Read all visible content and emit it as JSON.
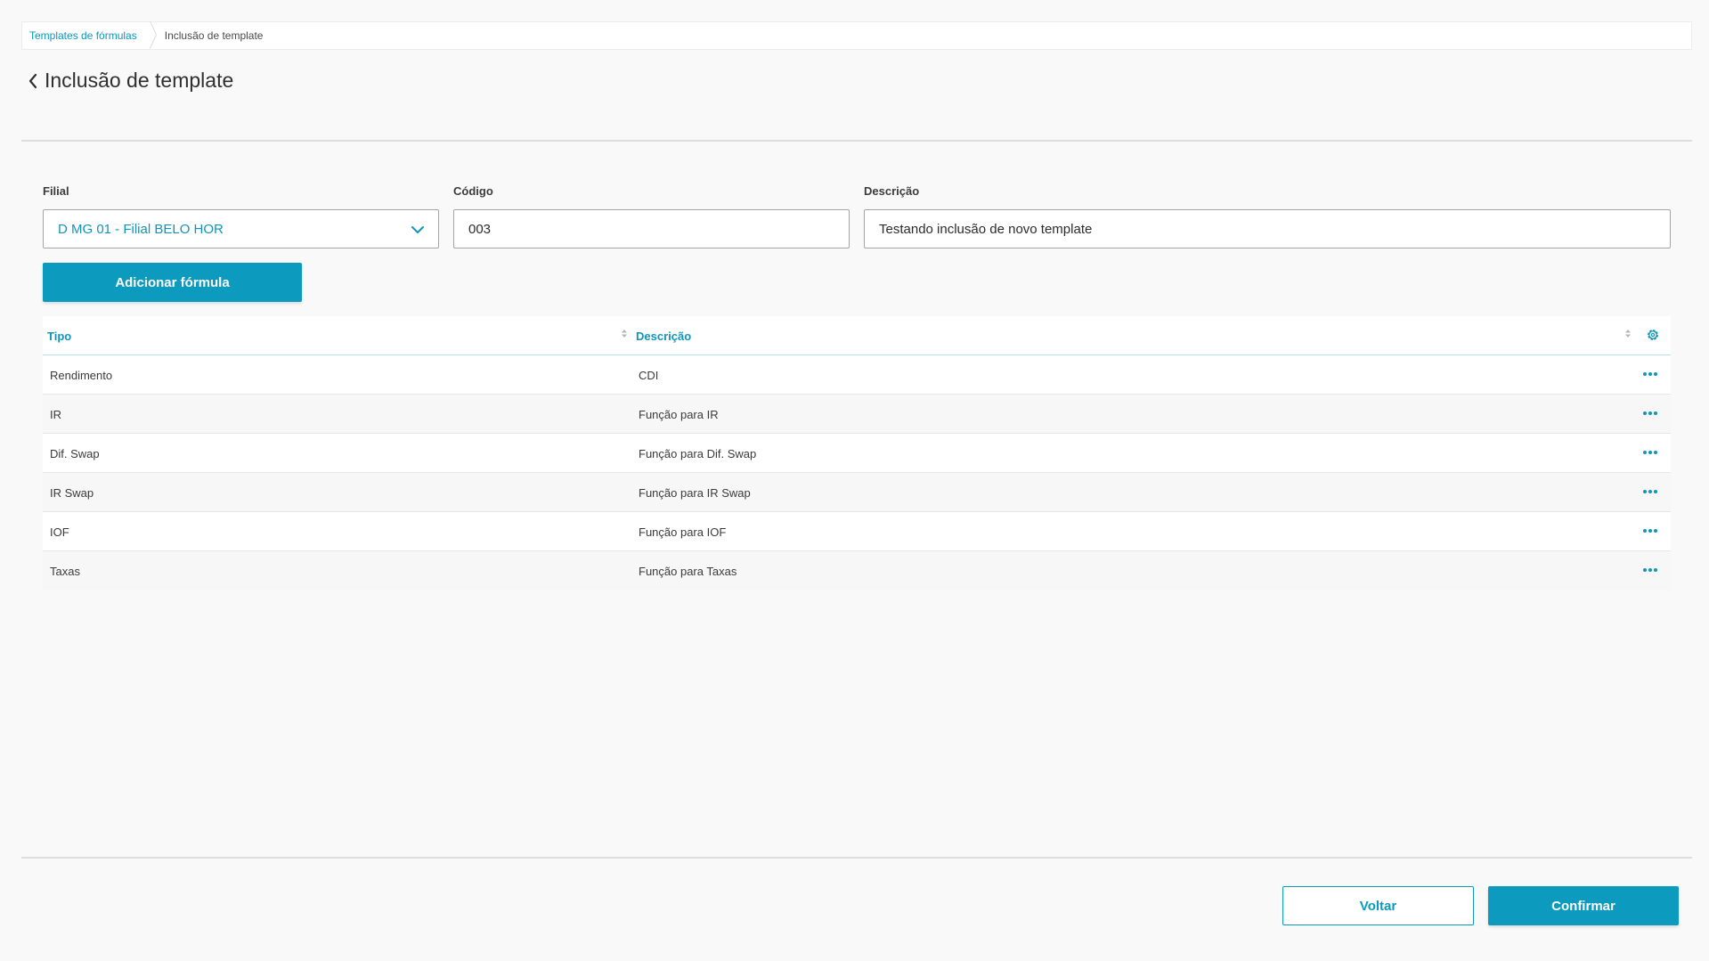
{
  "breadcrumb": {
    "items": [
      {
        "label": "Templates de fórmulas"
      },
      {
        "label": "Inclusão de template"
      }
    ]
  },
  "header": {
    "title": "Inclusão de template",
    "back_icon": "chevron-left-icon"
  },
  "form": {
    "filial": {
      "label": "Filial",
      "value": "D MG 01 - Filial BELO HOR",
      "icon": "chevron-down-icon"
    },
    "codigo": {
      "label": "Código",
      "value": "003"
    },
    "descricao": {
      "label": "Descrição",
      "value": "Testando inclusão de novo template"
    }
  },
  "add_formula_label": "Adicionar fórmula",
  "table": {
    "columns": [
      "Tipo",
      "Descrição"
    ],
    "settings_icon": "gear-icon",
    "row_action_icon": "more-horizontal-icon",
    "rows": [
      {
        "tipo": "Rendimento",
        "descricao": "CDI"
      },
      {
        "tipo": "IR",
        "descricao": "Função para IR"
      },
      {
        "tipo": "Dif. Swap",
        "descricao": "Função para Dif. Swap"
      },
      {
        "tipo": "IR Swap",
        "descricao": "Função para IR Swap"
      },
      {
        "tipo": "IOF",
        "descricao": "Função para IOF"
      },
      {
        "tipo": "Taxas",
        "descricao": "Função para Taxas"
      }
    ]
  },
  "footer": {
    "back_label": "Voltar",
    "confirm_label": "Confirmar"
  },
  "colors": {
    "primary": "#0c9abe",
    "link": "#1194bb",
    "background": "#f9f9f9"
  }
}
